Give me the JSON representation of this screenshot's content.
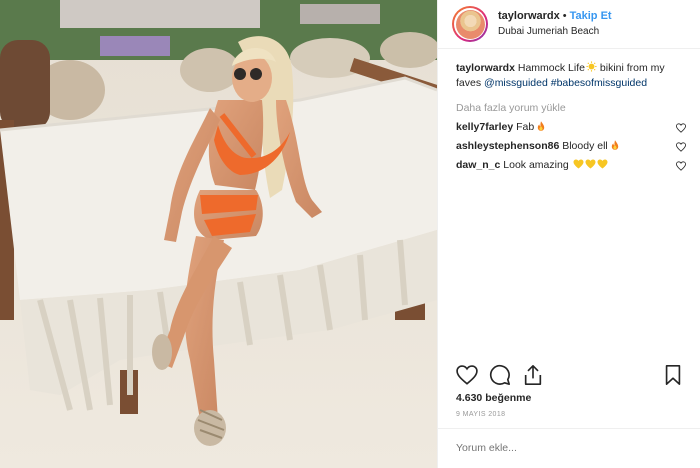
{
  "header": {
    "username": "taylorwardx",
    "separator": "•",
    "follow_label": "Takip Et",
    "location": "Dubai Jumeriah Beach"
  },
  "caption": {
    "username": "taylorwardx",
    "text_part1": "Hammock Life",
    "emoji": "sun-emoji",
    "text_part2": "bikini from my faves",
    "mention": "@missguided",
    "hashtag": "#babesofmissguided"
  },
  "load_more_label": "Daha fazla yorum yükle",
  "comments": [
    {
      "username": "kelly7farley",
      "text": "Fab",
      "emoji": "fire-emoji"
    },
    {
      "username": "ashleystephenson86",
      "text": "Bloody ell",
      "emoji": "fire-emoji"
    },
    {
      "username": "daw_n_c",
      "text": "Look amazing",
      "emoji": "yellow-heart-emoji x3"
    }
  ],
  "actions": {
    "like_icon": "heart-icon",
    "comment_icon": "comment-icon",
    "share_icon": "share-icon",
    "save_icon": "bookmark-icon"
  },
  "likes_text": "4.630 beğenme",
  "date_text": "9 MAYIS 2018",
  "comment_placeholder": "Yorum ekle...",
  "colors": {
    "link": "#3897f0",
    "tag": "#003569",
    "muted": "#999999",
    "text": "#262626"
  }
}
